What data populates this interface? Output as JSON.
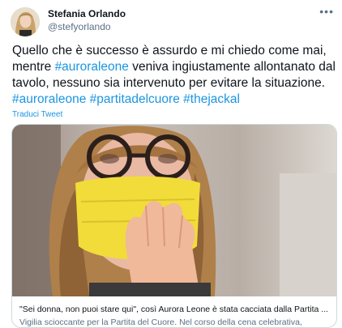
{
  "tweet": {
    "author_name": "Stefania Orlando",
    "author_handle": "@stefyorlando",
    "more_label": "•••",
    "text": {
      "p1": "Quello che è successo è assurdo e mi chiedo come mai, mentre ",
      "tag1": "#auroraleone",
      "p2": " veniva ingiustamente allontanato dal tavolo, nessuno sia intervenuto per evitare la situazione.  ",
      "tag2": "#auroraleone",
      "sp1": " ",
      "tag3": "#partitadelcuore",
      "sp2": " ",
      "tag4": "#thejackal"
    },
    "translate_label": "Traduci Tweet"
  },
  "card": {
    "title": "\"Sei donna, non puoi stare qui\", così Aurora Leone è stata cacciata dalla Partita ...",
    "description": "Vigilia scioccante per la Partita del Cuore. Nel corso della cena celebrativa,"
  },
  "colors": {
    "link": "#1b95e0",
    "secondary_text": "#5b7083",
    "mask": "#f2dc3a"
  }
}
